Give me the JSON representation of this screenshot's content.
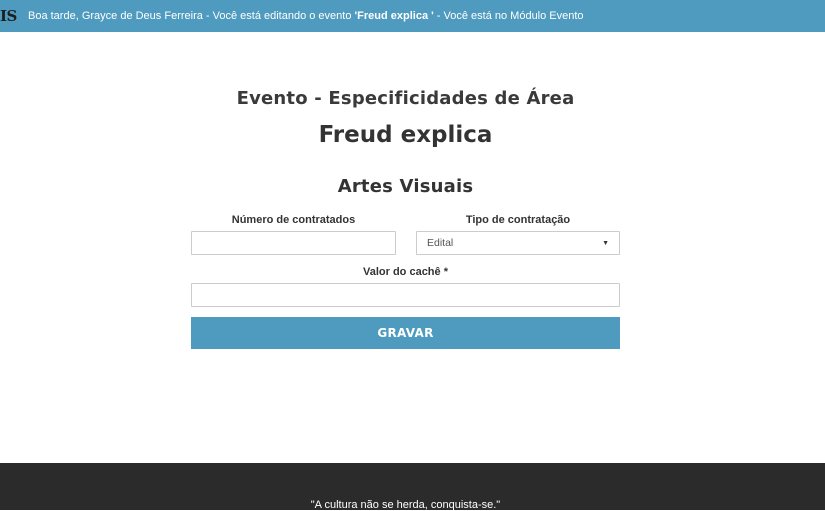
{
  "topbar": {
    "logo_text": "IS",
    "greeting_prefix": "Boa tarde, Grayce de Deus Ferreira - Você está editando o evento ",
    "event_name_quoted": "'Freud explica '",
    "greeting_suffix": " - Você está no Módulo Evento"
  },
  "page": {
    "section_title": "Evento - Especificidades de Área",
    "event_title": "Freud explica",
    "area_title": "Artes Visuais"
  },
  "form": {
    "num_contratados": {
      "label": "Número de contratados",
      "value": ""
    },
    "tipo_contratacao": {
      "label": "Tipo de contratação",
      "selected": "Edital"
    },
    "valor_cache": {
      "label": "Valor do cachê *",
      "value": ""
    },
    "submit_label": "GRAVAR"
  },
  "footer": {
    "quote": "\"A cultura não se herda, conquista-se.\""
  },
  "colors": {
    "accent": "#4f9bbf",
    "footer_bg": "#2b2b2b"
  }
}
